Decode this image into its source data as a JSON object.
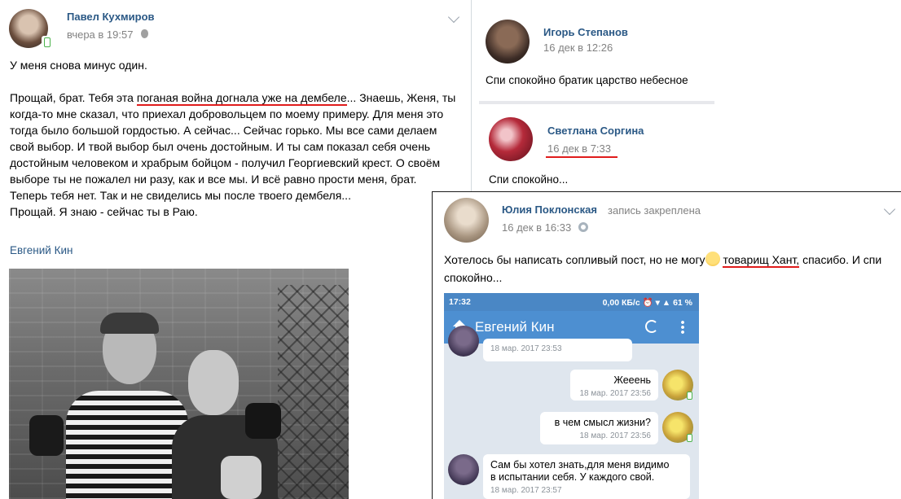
{
  "left_post": {
    "author": "Павел Кухмиров",
    "time": "вчера в 19:57",
    "paragraph1": "У меня снова минус один.",
    "line1_a": "Прощай, брат. Тебя эта ",
    "line1_underlined": "поганая война догнала уже на дембеле",
    "line1_b": "... Знаешь, Женя, ты",
    "rest": "когда-то мне сказал, что приехал добровольцем по моему примеру. Для меня это\nтогда было большой гордостью. А сейчас... Сейчас горько. Мы все сами делаем\nсвой выбор. И твой выбор был очень достойным. И ты сам показал себя очень\nдостойным человеком и храбрым бойцом - получил Георгиевский крест. О своём\nвыборе ты не пожалел ни разу, как и все мы. И всё равно прости меня, брат.\nТеперь тебя нет. Так и не свиделись мы после твоего дембеля...\nПрощай. Я знаю - сейчас ты в Раю.",
    "signature": "Евгений Кин"
  },
  "comments": [
    {
      "author": "Игорь Степанов",
      "time": "16 дек в 12:26",
      "text": "Спи спокойно братик царство небесное"
    },
    {
      "author": "Светлана Соргина",
      "time": "16 дек в 7:33",
      "text": "Спи спокойно..."
    }
  ],
  "overlay_post": {
    "author": "Юлия Поклонская",
    "pinned": "запись закреплена",
    "time": "16 дек в 16:33",
    "text_a": "Хотелось бы написать сопливый пост, но не могу",
    "text_underlined": "товарищ Хант,",
    "text_b": " спасибо. И спи",
    "text_c": "спокойно..."
  },
  "phone": {
    "status_time": "17:32",
    "status_right": "0,00 КБ/с ⏰ ▾ ▲ 61 %",
    "title": "Евгений Кин",
    "messages": [
      {
        "text": "",
        "time": "18 мар. 2017 23:53"
      },
      {
        "text": "Жееень",
        "time": "18 мар. 2017 23:56"
      },
      {
        "text": "в чем смысл жизни?",
        "time": "18 мар. 2017 23:56"
      },
      {
        "text": "Сам бы хотел знать,для меня видимо\nв испытании себя. У каждого свой.",
        "time": "18 мар. 2017 23:57"
      }
    ]
  },
  "colors": {
    "link": "#2a5885",
    "muted": "#828282",
    "underline": "#e01c1c",
    "phone_bar": "#4d8fd1"
  }
}
